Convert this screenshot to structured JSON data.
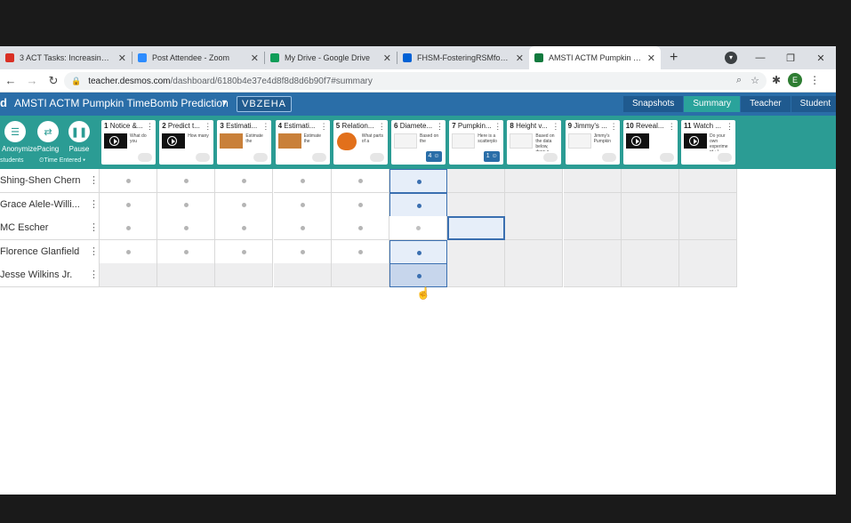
{
  "browser": {
    "tabs": [
      {
        "title": "3 ACT Tasks: Increasing Str",
        "icon": "gmail-icon",
        "color": "#d93025",
        "width": 148
      },
      {
        "title": "Post Attendee - Zoom",
        "icon": "zoom-icon",
        "color": "#2d8cff",
        "width": 148
      },
      {
        "title": "My Drive - Google Drive",
        "icon": "drive-icon",
        "color": "#0f9d58",
        "width": 148
      },
      {
        "title": "FHSM-FosteringRSMforAll",
        "icon": "box-icon",
        "color": "#0061d5",
        "width": 148
      },
      {
        "title": "AMSTI ACTM Pumpkin Tim",
        "icon": "desmos-icon",
        "color": "#127a3e",
        "width": 148,
        "active": true
      }
    ],
    "new_tab": "+",
    "url_host": "teacher.desmos.com",
    "url_path": "/dashboard/6180b4e37e4d8f8d8d6b90f7#summary",
    "avatar_letter": "E",
    "window": {
      "minimize": "—",
      "restore": "❐",
      "close": "✕"
    }
  },
  "header": {
    "logo_letter": "d",
    "title": "AMSTI ACTM Pumpkin TimeBomb Prediction",
    "class_code": "VBZEHA",
    "view_tabs": [
      "Snapshots",
      "Summary",
      "Teacher",
      "Student"
    ],
    "active_view": "Summary"
  },
  "strip": {
    "controls": [
      {
        "label": "Anonymize",
        "icon": "anonymize-icon",
        "glyph": "☰"
      },
      {
        "label": "Pacing",
        "icon": "pacing-icon",
        "glyph": "⇄"
      },
      {
        "label": "Pause",
        "icon": "pause-icon",
        "glyph": "❚❚"
      }
    ],
    "students_label": "students",
    "time_label": "Time Entered"
  },
  "screens": [
    {
      "num": "1",
      "title": "Notice &...",
      "thumb": "video",
      "text": "What do you"
    },
    {
      "num": "2",
      "title": "Predict t...",
      "thumb": "video",
      "text": "How many"
    },
    {
      "num": "3",
      "title": "Estimati...",
      "thumb": "pumpkin",
      "text": "Estimate the"
    },
    {
      "num": "4",
      "title": "Estimati...",
      "thumb": "pumpkin",
      "text": "Estimate the"
    },
    {
      "num": "5",
      "title": "Relation...",
      "thumb": "pumpkin-big",
      "text": "What parts of a"
    },
    {
      "num": "6",
      "title": "Diamete...",
      "thumb": "graph",
      "text": "Based on the",
      "count": "4"
    },
    {
      "num": "7",
      "title": "Pumpkin...",
      "thumb": "graph",
      "text": "Here is a scatterplo",
      "count": "1"
    },
    {
      "num": "8",
      "title": "Height v...",
      "thumb": "graph",
      "text": "Based on the data below, draw a"
    },
    {
      "num": "9",
      "title": "Jimmy's ...",
      "thumb": "graph",
      "text": "Jimmy's Pumpkin"
    },
    {
      "num": "10",
      "title": "Reveal...",
      "thumb": "video",
      "text": ""
    },
    {
      "num": "11",
      "title": "Watch ...",
      "thumb": "video",
      "text": "Do your own experime nt :-)"
    }
  ],
  "students": [
    {
      "name": "Shing-Shen Chern",
      "cells": [
        "d",
        "d",
        "d",
        "d",
        "d",
        "sel",
        "e",
        "e",
        "e",
        "e",
        "e"
      ]
    },
    {
      "name": "Grace Alele-Willi...",
      "cells": [
        "d",
        "d",
        "d",
        "d",
        "d",
        "sel",
        "e",
        "e",
        "e",
        "e",
        "e"
      ]
    },
    {
      "name": "MC Escher",
      "cells": [
        "d",
        "d",
        "d",
        "d",
        "d",
        "w",
        "hl",
        "e",
        "e",
        "e",
        "e"
      ]
    },
    {
      "name": "Florence Glanfield",
      "cells": [
        "d",
        "d",
        "d",
        "d",
        "d",
        "sel",
        "e",
        "e",
        "e",
        "e",
        "e"
      ]
    },
    {
      "name": "Jesse Wilkins Jr.",
      "cells": [
        "e",
        "e",
        "e",
        "e",
        "e",
        "seld",
        "e",
        "e",
        "e",
        "e",
        "e"
      ]
    }
  ],
  "cursor_glyph": "☝"
}
